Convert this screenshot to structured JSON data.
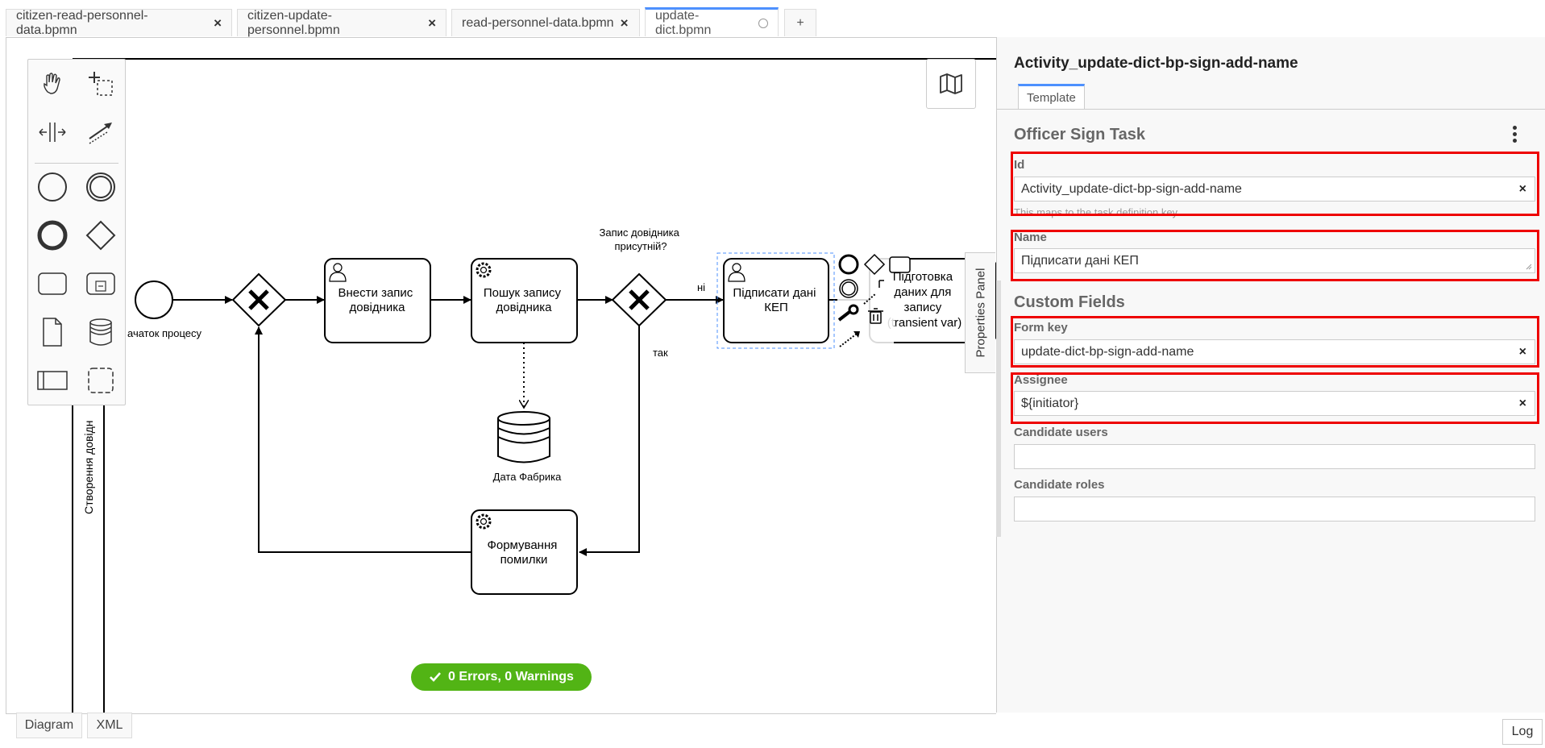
{
  "tabs": [
    {
      "label": "citizen-read-personnel-data.bpmn"
    },
    {
      "label": "citizen-update-personnel.bpmn"
    },
    {
      "label": "read-personnel-data.bpmn"
    },
    {
      "label": "update-dict.bpmn"
    },
    {
      "label": "+"
    }
  ],
  "diagram": {
    "lane_label": "Створення довідн",
    "start_label": "ачаток процесу",
    "task_enter": [
      "Внести запис",
      "довідника"
    ],
    "task_search": [
      "Пошук запису",
      "довідника"
    ],
    "gateway_question": [
      "Запис довідника",
      "присутній?"
    ],
    "flow_no": "ні",
    "flow_yes": "так",
    "task_sign": [
      "Підписати дані",
      "КЕП"
    ],
    "task_prepare": [
      "Підготовка",
      "даних для",
      "запису",
      "(transient var)"
    ],
    "datastore_label": "Дата Фабрика",
    "task_error": [
      "Формування",
      "помилки"
    ]
  },
  "status": {
    "text": "0 Errors, 0 Warnings"
  },
  "props_toggle": "Properties Panel",
  "panel": {
    "title": "Activity_update-dict-bp-sign-add-name",
    "tab": "Template",
    "group1": "Officer Sign Task",
    "id_label": "Id",
    "id_value": "Activity_update-dict-bp-sign-add-name",
    "id_desc": "This maps to the task definition key.",
    "name_label": "Name",
    "name_value": "Підписати дані КЕП",
    "group2": "Custom Fields",
    "formkey_label": "Form key",
    "formkey_value": "update-dict-bp-sign-add-name",
    "assignee_label": "Assignee",
    "assignee_value": "${initiator}",
    "candusers_label": "Candidate users",
    "candroles_label": "Candidate roles",
    "clear": "×"
  },
  "bottom": {
    "diagram": "Diagram",
    "xml": "XML",
    "log": "Log"
  },
  "colors": {
    "accent": "#4d90fe",
    "success": "#52b415",
    "highlight": "#e00000"
  }
}
